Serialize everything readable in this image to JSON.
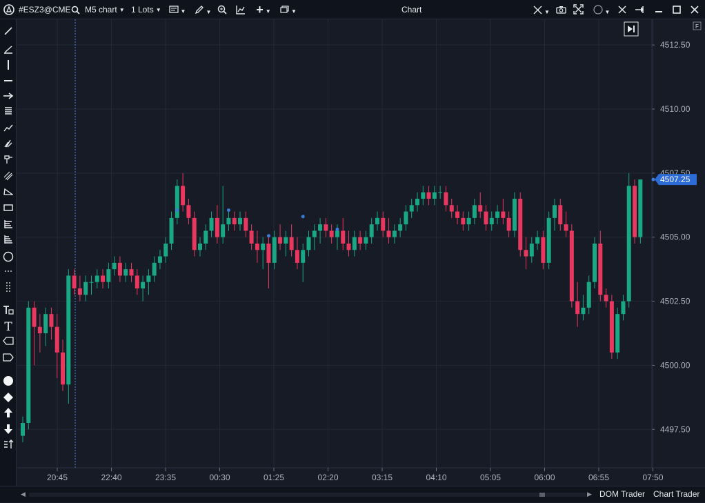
{
  "toolbar": {
    "symbol": "#ESZ3@CME",
    "timeframe": "M5 chart",
    "lots": "1 Lots",
    "window_title": "Chart",
    "icons": [
      "app-logo-icon",
      "search-icon",
      "template-icon",
      "pencil-icon",
      "zoom-icon",
      "indicators-icon",
      "plus-icon",
      "window-icon",
      "crosshair-icon",
      "camera-icon",
      "fullscreen-icon",
      "circle-icon",
      "tools-icon",
      "pin-icon",
      "minimize-icon",
      "maximize-icon",
      "close-icon"
    ]
  },
  "sidebar": {
    "tools": [
      "line-tool-icon",
      "trend-angle-icon",
      "vertical-line-icon",
      "horizontal-line-icon",
      "arrow-line-icon",
      "horizontal-lines-icon",
      "polyline-icon",
      "pitchfork-icon",
      "gann-icon",
      "parallel-channel-icon",
      "triangle-icon",
      "rectangle-icon",
      "fibonacci-icon",
      "fibonacci-extension-icon",
      "ellipse-icon",
      "cycle-lines-icon",
      "vertical-cycle-icon",
      "text-label-icon",
      "text-icon",
      "price-label-icon",
      "tag-icon",
      "dot-icon",
      "diamond-icon",
      "arrow-up-icon",
      "arrow-down-icon",
      "sort-icon"
    ]
  },
  "bottom": {
    "dom_trader": "DOM Trader",
    "chart_trader": "Chart Trader"
  },
  "chart_data": {
    "type": "candlestick",
    "symbol": "#ESZ3@CME",
    "timeframe": "M5",
    "y_ticks": [
      "4512.50",
      "4510.00",
      "4507.50",
      "4505.00",
      "4502.50",
      "4500.00",
      "4497.50"
    ],
    "ylim": [
      4496.0,
      4513.5
    ],
    "x_ticks": [
      "20:45",
      "22:40",
      "23:35",
      "00:30",
      "01:25",
      "02:20",
      "03:15",
      "04:10",
      "05:05",
      "06:00",
      "06:55",
      "07:50"
    ],
    "current_price": "4507.25",
    "colors": {
      "up": "#1aa784",
      "down": "#e8385f",
      "background": "#161b26",
      "grid": "#222836",
      "price_label": "#2d6bd6",
      "session_line": "#4d83d9",
      "marker": "#3c7bd6"
    },
    "candles": [
      [
        4497.25,
        4498.0,
        4497.0,
        4497.75
      ],
      [
        4497.75,
        4502.5,
        4497.5,
        4502.25
      ],
      [
        4502.25,
        4502.5,
        4500.0,
        4501.5
      ],
      [
        4501.5,
        4502.0,
        4500.5,
        4501.25
      ],
      [
        4501.25,
        4502.25,
        4500.75,
        4502.0
      ],
      [
        4502.0,
        4502.25,
        4501.0,
        4501.5
      ],
      [
        4501.5,
        4502.0,
        4499.5,
        4500.5
      ],
      [
        4500.5,
        4501.0,
        4499.0,
        4499.25
      ],
      [
        4499.25,
        4503.75,
        4498.5,
        4503.5
      ],
      [
        4503.5,
        4503.75,
        4502.75,
        4503.0
      ],
      [
        4503.0,
        4503.5,
        4502.5,
        4502.75
      ],
      [
        4502.75,
        4503.5,
        4502.5,
        4503.25
      ],
      [
        4503.25,
        4503.5,
        4502.75,
        4503.25
      ],
      [
        4503.25,
        4503.75,
        4503.0,
        4503.5
      ],
      [
        4503.5,
        4503.75,
        4503.0,
        4503.25
      ],
      [
        4503.25,
        4504.0,
        4503.0,
        4503.75
      ],
      [
        4503.75,
        4504.25,
        4503.5,
        4504.0
      ],
      [
        4504.0,
        4504.25,
        4503.25,
        4503.5
      ],
      [
        4503.5,
        4504.0,
        4503.25,
        4503.75
      ],
      [
        4503.75,
        4504.0,
        4503.25,
        4503.5
      ],
      [
        4503.5,
        4503.75,
        4502.75,
        4503.0
      ],
      [
        4503.0,
        4503.5,
        4502.5,
        4503.25
      ],
      [
        4503.25,
        4503.75,
        4502.75,
        4503.5
      ],
      [
        4503.5,
        4504.25,
        4503.25,
        4504.0
      ],
      [
        4504.0,
        4504.5,
        4503.75,
        4504.25
      ],
      [
        4504.25,
        4505.0,
        4504.0,
        4504.75
      ],
      [
        4504.75,
        4506.0,
        4504.5,
        4505.75
      ],
      [
        4505.75,
        4507.25,
        4505.5,
        4507.0
      ],
      [
        4507.0,
        4507.5,
        4506.0,
        4506.25
      ],
      [
        4506.25,
        4506.5,
        4505.5,
        4505.75
      ],
      [
        4505.75,
        4506.0,
        4504.25,
        4504.5
      ],
      [
        4504.5,
        4505.0,
        4504.25,
        4504.75
      ],
      [
        4504.75,
        4505.5,
        4504.5,
        4505.25
      ],
      [
        4505.25,
        4506.0,
        4505.0,
        4505.75
      ],
      [
        4505.75,
        4506.25,
        4504.75,
        4505.0
      ],
      [
        4505.0,
        4507.0,
        4504.75,
        4505.5
      ],
      [
        4505.5,
        4506.0,
        4505.25,
        4505.75
      ],
      [
        4505.75,
        4506.0,
        4505.25,
        4505.5
      ],
      [
        4505.5,
        4506.0,
        4505.25,
        4505.75
      ],
      [
        4505.75,
        4506.0,
        4505.0,
        4505.25
      ],
      [
        4505.25,
        4505.5,
        4504.5,
        4504.75
      ],
      [
        4504.75,
        4505.25,
        4504.0,
        4504.5
      ],
      [
        4504.5,
        4505.0,
        4503.75,
        4504.75
      ],
      [
        4504.75,
        4505.0,
        4503.0,
        4504.0
      ],
      [
        4504.0,
        4505.25,
        4503.75,
        4505.0
      ],
      [
        4505.0,
        4505.5,
        4504.5,
        4504.75
      ],
      [
        4504.75,
        4505.25,
        4504.25,
        4505.0
      ],
      [
        4505.0,
        4505.5,
        4504.25,
        4504.5
      ],
      [
        4504.5,
        4505.0,
        4503.75,
        4504.0
      ],
      [
        4504.0,
        4504.75,
        4503.25,
        4504.5
      ],
      [
        4504.5,
        4505.25,
        4504.25,
        4505.0
      ],
      [
        4505.0,
        4505.5,
        4504.5,
        4505.25
      ],
      [
        4505.25,
        4505.75,
        4504.75,
        4505.5
      ],
      [
        4505.5,
        4505.75,
        4505.0,
        4505.25
      ],
      [
        4505.25,
        4505.5,
        4504.75,
        4505.0
      ],
      [
        4505.0,
        4505.5,
        4504.5,
        4505.25
      ],
      [
        4505.25,
        4505.75,
        4504.5,
        4504.75
      ],
      [
        4504.75,
        4505.25,
        4504.25,
        4504.5
      ],
      [
        4504.5,
        4505.25,
        4504.25,
        4505.0
      ],
      [
        4505.0,
        4505.25,
        4504.5,
        4504.75
      ],
      [
        4504.75,
        4505.25,
        4504.5,
        4505.0
      ],
      [
        4505.0,
        4505.75,
        4504.75,
        4505.5
      ],
      [
        4505.5,
        4506.0,
        4505.25,
        4505.75
      ],
      [
        4505.75,
        4506.0,
        4505.0,
        4505.25
      ],
      [
        4505.25,
        4505.75,
        4504.75,
        4505.0
      ],
      [
        4505.0,
        4505.5,
        4504.75,
        4505.25
      ],
      [
        4505.25,
        4505.75,
        4505.0,
        4505.5
      ],
      [
        4505.5,
        4506.25,
        4505.25,
        4506.0
      ],
      [
        4506.0,
        4506.5,
        4505.75,
        4506.25
      ],
      [
        4506.25,
        4506.75,
        4506.0,
        4506.5
      ],
      [
        4506.5,
        4507.0,
        4506.25,
        4506.75
      ],
      [
        4506.75,
        4507.0,
        4506.25,
        4506.5
      ],
      [
        4506.5,
        4507.0,
        4506.25,
        4506.75
      ],
      [
        4506.75,
        4507.0,
        4506.5,
        4506.75
      ],
      [
        4506.75,
        4507.0,
        4506.0,
        4506.25
      ],
      [
        4506.25,
        4506.5,
        4505.75,
        4506.0
      ],
      [
        4506.0,
        4506.25,
        4505.5,
        4505.75
      ],
      [
        4505.75,
        4506.0,
        4505.25,
        4505.5
      ],
      [
        4505.5,
        4506.0,
        4505.25,
        4505.75
      ],
      [
        4505.75,
        4506.5,
        4505.5,
        4506.25
      ],
      [
        4506.25,
        4506.75,
        4505.75,
        4506.0
      ],
      [
        4506.0,
        4506.25,
        4505.25,
        4505.5
      ],
      [
        4505.5,
        4506.0,
        4505.25,
        4505.75
      ],
      [
        4505.75,
        4506.25,
        4505.5,
        4506.0
      ],
      [
        4506.0,
        4506.5,
        4505.5,
        4505.75
      ],
      [
        4505.75,
        4506.0,
        4505.0,
        4505.25
      ],
      [
        4505.25,
        4506.75,
        4505.0,
        4506.5
      ],
      [
        4506.5,
        4506.75,
        4504.25,
        4504.5
      ],
      [
        4504.5,
        4505.0,
        4503.75,
        4504.25
      ],
      [
        4504.25,
        4505.0,
        4504.0,
        4504.75
      ],
      [
        4504.75,
        4505.25,
        4504.5,
        4505.0
      ],
      [
        4505.0,
        4505.25,
        4503.75,
        4504.0
      ],
      [
        4504.0,
        4506.0,
        4503.75,
        4505.75
      ],
      [
        4505.75,
        4506.5,
        4505.25,
        4506.25
      ],
      [
        4506.25,
        4506.5,
        4505.25,
        4505.5
      ],
      [
        4505.5,
        4506.0,
        4505.0,
        4505.25
      ],
      [
        4505.25,
        4505.5,
        4502.25,
        4502.5
      ],
      [
        4502.5,
        4503.25,
        4501.5,
        4502.0
      ],
      [
        4502.0,
        4502.75,
        4501.75,
        4502.25
      ],
      [
        4502.25,
        4503.5,
        4502.0,
        4503.25
      ],
      [
        4503.25,
        4505.0,
        4503.0,
        4504.75
      ],
      [
        4504.75,
        4505.25,
        4502.5,
        4502.75
      ],
      [
        4502.75,
        4503.0,
        4502.25,
        4502.5
      ],
      [
        4502.5,
        4502.75,
        4500.25,
        4500.5
      ],
      [
        4500.5,
        4502.25,
        4500.25,
        4502.0
      ],
      [
        4502.0,
        4502.75,
        4501.75,
        4502.5
      ],
      [
        4502.5,
        4507.5,
        4502.25,
        4507.0
      ],
      [
        4507.0,
        4507.25,
        4504.75,
        4505.0
      ],
      [
        4505.0,
        4507.25,
        4504.75,
        4507.25
      ]
    ],
    "markers": [
      [
        27,
        4506.0
      ],
      [
        36,
        4506.0
      ],
      [
        43,
        4505.0
      ],
      [
        49,
        4505.75
      ],
      [
        55,
        4505.25
      ]
    ]
  }
}
